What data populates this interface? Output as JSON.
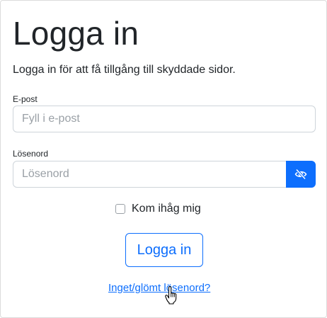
{
  "page": {
    "title": "Logga in",
    "subtitle": "Logga in för att få tillgång till skyddade sidor."
  },
  "form": {
    "email": {
      "label": "E-post",
      "value": "",
      "placeholder": "Fyll i e-post"
    },
    "password": {
      "label": "Lösenord",
      "value": "",
      "placeholder": "Lösenord",
      "toggle_icon": "eye-slash-icon"
    },
    "remember": {
      "label": "Kom ihåg mig",
      "checked": false
    },
    "submit_label": "Logga in",
    "forgot_link": "Inget/glömt lösenord?"
  },
  "colors": {
    "primary": "#0d6efd",
    "text": "#212529",
    "border": "#ced4da",
    "placeholder": "#9aa0a6"
  },
  "cursor_icon": "hand-pointer-icon"
}
